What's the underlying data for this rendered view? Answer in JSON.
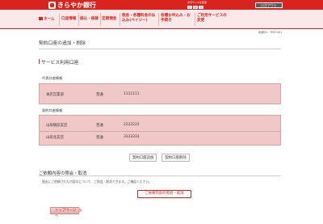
{
  "header": {
    "logo_text": "きらやか銀行",
    "font_size_label": "文字サイズを変更",
    "font_size_options": [
      "小",
      "中",
      "大"
    ],
    "logout_label": "ログアウト"
  },
  "nav": {
    "items": [
      {
        "label": "ホーム"
      },
      {
        "label": "口座情報"
      },
      {
        "label": "振込・振替"
      },
      {
        "label": "定期預金"
      },
      {
        "label": "税金・各種料金の払込み(ペイジー)"
      },
      {
        "label": "各種お申込み・お手続き"
      },
      {
        "label": "ご利用サービスの変更"
      }
    ]
  },
  "screen_id": "画面ID：RMC001",
  "page_title": "契約口座の追加・削除",
  "service_section": {
    "title": "サービス利用口座",
    "representative": {
      "label": "代表口座情報",
      "rows": [
        {
          "branch": "本店営業部",
          "type": "普通",
          "number": "1111111"
        }
      ]
    },
    "contract": {
      "label": "契約口座情報",
      "rows": [
        {
          "branch": "山形駅前支店",
          "type": "普通",
          "number": "2222222"
        },
        {
          "branch": "山形北支店",
          "type": "普通",
          "number": "3333333"
        }
      ]
    }
  },
  "actions": {
    "add_label": "契約口座追加",
    "delete_label": "契約口座削除"
  },
  "inquiry": {
    "title": "ご依頼内容の照会・取消",
    "description": "過去にご依頼された内容のについて、ご照会・取消できます。ご確認ください。",
    "button_label": "ご依頼内容の照会・取消"
  },
  "top_button_label": "トップページへ"
}
